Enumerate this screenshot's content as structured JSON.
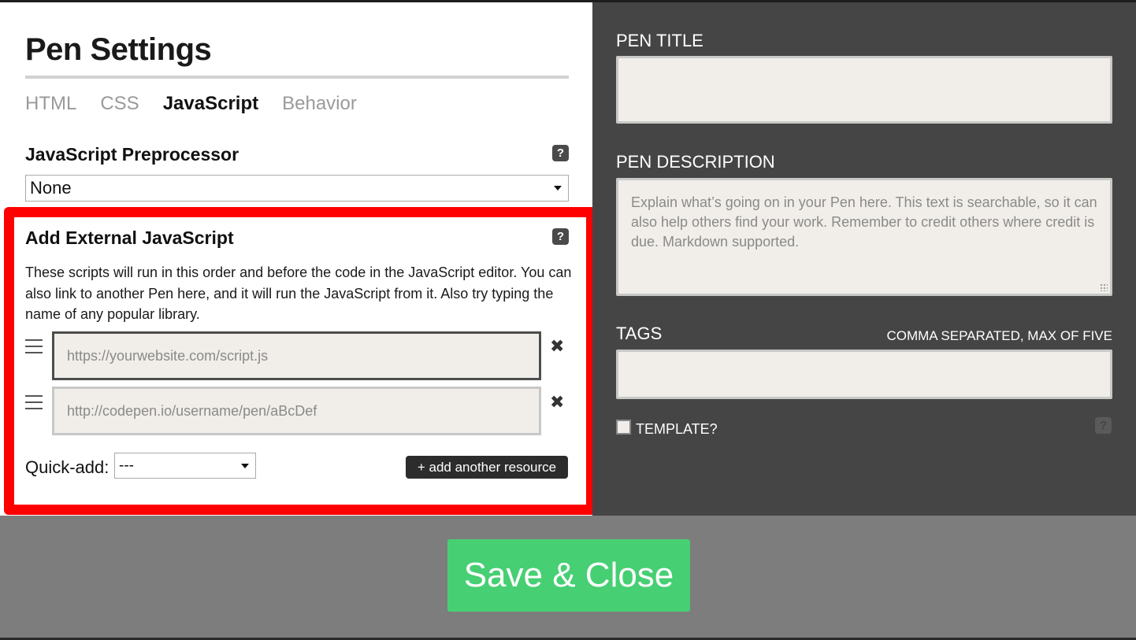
{
  "dialog": {
    "title": "Pen Settings"
  },
  "tabs": [
    {
      "label": "HTML",
      "active": false
    },
    {
      "label": "CSS",
      "active": false
    },
    {
      "label": "JavaScript",
      "active": true
    },
    {
      "label": "Behavior",
      "active": false
    }
  ],
  "preprocessor": {
    "heading": "JavaScript Preprocessor",
    "help": "?",
    "selected": "None"
  },
  "external": {
    "heading": "Add External JavaScript",
    "help": "?",
    "description": "These scripts will run in this order and before the code in the JavaScript editor. You can also link to another Pen here, and it will run the JavaScript from it. Also try typing the name of any popular library.",
    "inputs": [
      {
        "placeholder": "https://yourwebsite.com/script.js"
      },
      {
        "placeholder": "http://codepen.io/username/pen/aBcDef"
      }
    ],
    "remove_icon": "✖",
    "quick_add_label": "Quick-add:",
    "quick_add_selected": "---",
    "add_button": "+ add another resource"
  },
  "details": {
    "title_label": "PEN TITLE",
    "title_value": "",
    "description_label": "PEN DESCRIPTION",
    "description_placeholder": "Explain what’s going on in your Pen here. This text is searchable, so it can also help others find your work. Remember to credit others where credit is due. Markdown supported.",
    "tags_label": "TAGS",
    "tags_hint": "COMMA SEPARATED, MAX OF FIVE",
    "template_label": "TEMPLATE?",
    "help": "?"
  },
  "footer": {
    "save_label": "Save & Close"
  },
  "colors": {
    "highlight": "#ff0000",
    "save_button": "#47cf73",
    "dark_panel": "#454545"
  }
}
